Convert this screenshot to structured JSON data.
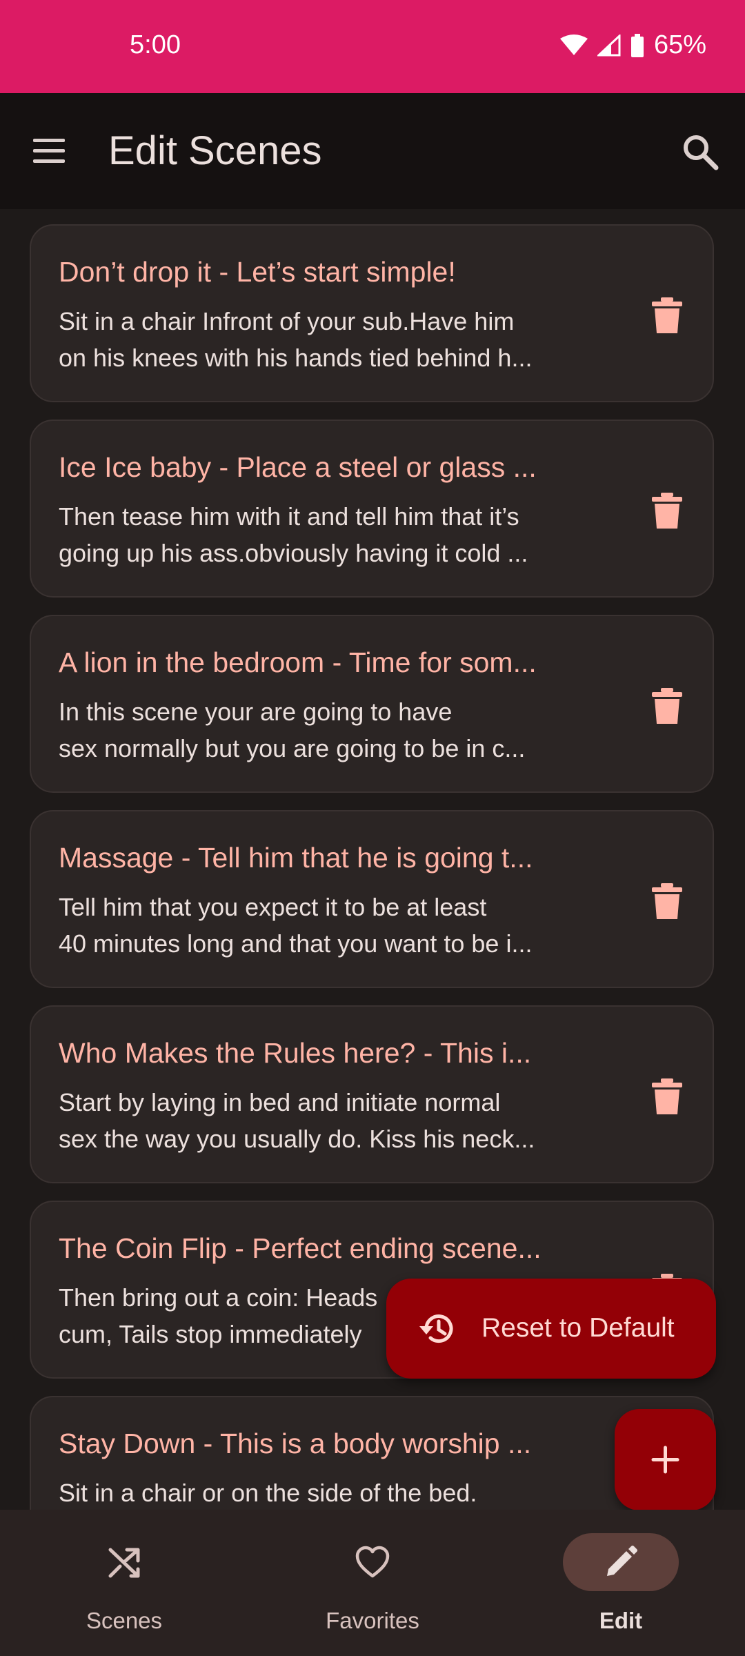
{
  "status_bar": {
    "time": "5:00",
    "battery": "65%",
    "icons": [
      "wifi-icon",
      "signal-icon",
      "battery-icon"
    ]
  },
  "app_bar": {
    "title": "Edit Scenes",
    "menu_icon": "menu-icon",
    "search_icon": "search-icon"
  },
  "scenes": [
    {
      "title": "Don’t drop it - Let’s start simple!",
      "line1": "Sit in a chair Infront of your sub.Have him",
      "line2": "on his knees with his hands tied behind h..."
    },
    {
      "title": "Ice Ice baby - Place a steel or glass ...",
      "line1": "Then tease him with it and tell him that it’s",
      "line2": "going up his ass.obviously having it cold ..."
    },
    {
      "title": "A lion in the bedroom - Time for som...",
      "line1": "In this scene your are going to have",
      "line2": "sex normally but you are going to be in c..."
    },
    {
      "title": "Massage - Tell him that he is going t...",
      "line1": "Tell him that you expect it to be at least",
      "line2": "40 minutes long and that you want to be i..."
    },
    {
      "title": "Who Makes the Rules here?  - This i...",
      "line1": "Start by laying in bed and initiate normal",
      "line2": "sex the way you usually do. Kiss his neck..."
    },
    {
      "title": "The Coin Flip - Perfect ending scene...",
      "line1": "Then bring out a coin:  Heads",
      "line2": "cum, Tails stop immediately"
    },
    {
      "title": "Stay Down - This is a body worship ...",
      "line1": "Sit in a chair or on the side of the bed.",
      "line2": ""
    }
  ],
  "fab_reset": {
    "label": "Reset to Default",
    "icon": "history-icon"
  },
  "fab_add": {
    "icon": "plus-icon"
  },
  "bottom_nav": {
    "items": [
      {
        "label": "Scenes",
        "icon": "shuffle-icon",
        "active": false
      },
      {
        "label": "Favorites",
        "icon": "heart-icon",
        "active": false
      },
      {
        "label": "Edit",
        "icon": "pencil-icon",
        "active": true
      }
    ]
  },
  "colors": {
    "status_bar": "#dc1b64",
    "accent_text": "#ffb4a6",
    "fab": "#930006",
    "card": "#2b2524"
  }
}
